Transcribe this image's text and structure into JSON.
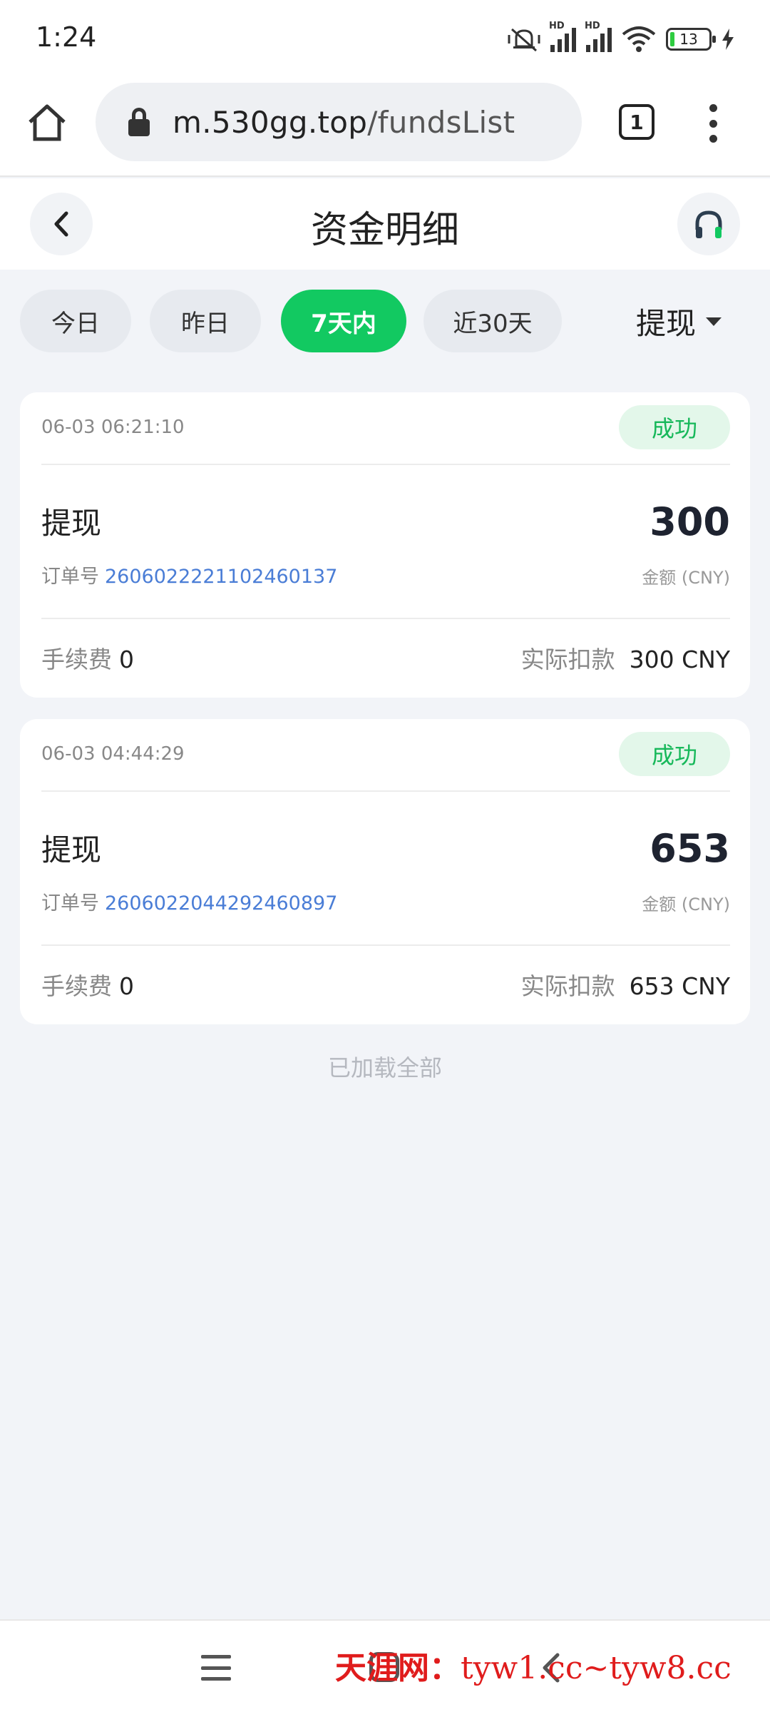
{
  "status_bar": {
    "time": "1:24",
    "battery": "13",
    "hd_label": "HD"
  },
  "browser": {
    "url_host": "m.530gg.top",
    "url_path": "/fundsList",
    "tab_count": "1"
  },
  "header": {
    "title": "资金明细"
  },
  "filters": {
    "chips": [
      "今日",
      "昨日",
      "7天内",
      "近30天"
    ],
    "active_index": 2,
    "type_label": "提现"
  },
  "records": [
    {
      "time": "06-03 06:21:10",
      "status": "成功",
      "type": "提现",
      "order_label": "订单号",
      "order_no": "2606022221102460137",
      "amount": "300",
      "amount_unit": "金额 (CNY)",
      "fee_label": "手续费",
      "fee": "0",
      "actual_label": "实际扣款",
      "actual": "300 CNY"
    },
    {
      "time": "06-03 04:44:29",
      "status": "成功",
      "type": "提现",
      "order_label": "订单号",
      "order_no": "2606022044292460897",
      "amount": "653",
      "amount_unit": "金额 (CNY)",
      "fee_label": "手续费",
      "fee": "0",
      "actual_label": "实际扣款",
      "actual": "653 CNY"
    }
  ],
  "list_footer": "已加载全部",
  "watermark": {
    "cn": "天涯网：",
    "en": "tyw1.cc~tyw8.cc"
  },
  "colors": {
    "accent": "#12c961",
    "success_text": "#17b85a",
    "order_link": "#4a7dd6",
    "watermark": "#e01c1c"
  },
  "icons": {
    "home": "home-icon",
    "lock": "lock-icon",
    "tabs": "tabs-icon",
    "menu": "more-vertical-icon",
    "back": "chevron-left-icon",
    "support": "headset-icon",
    "caret": "caret-down-icon"
  }
}
